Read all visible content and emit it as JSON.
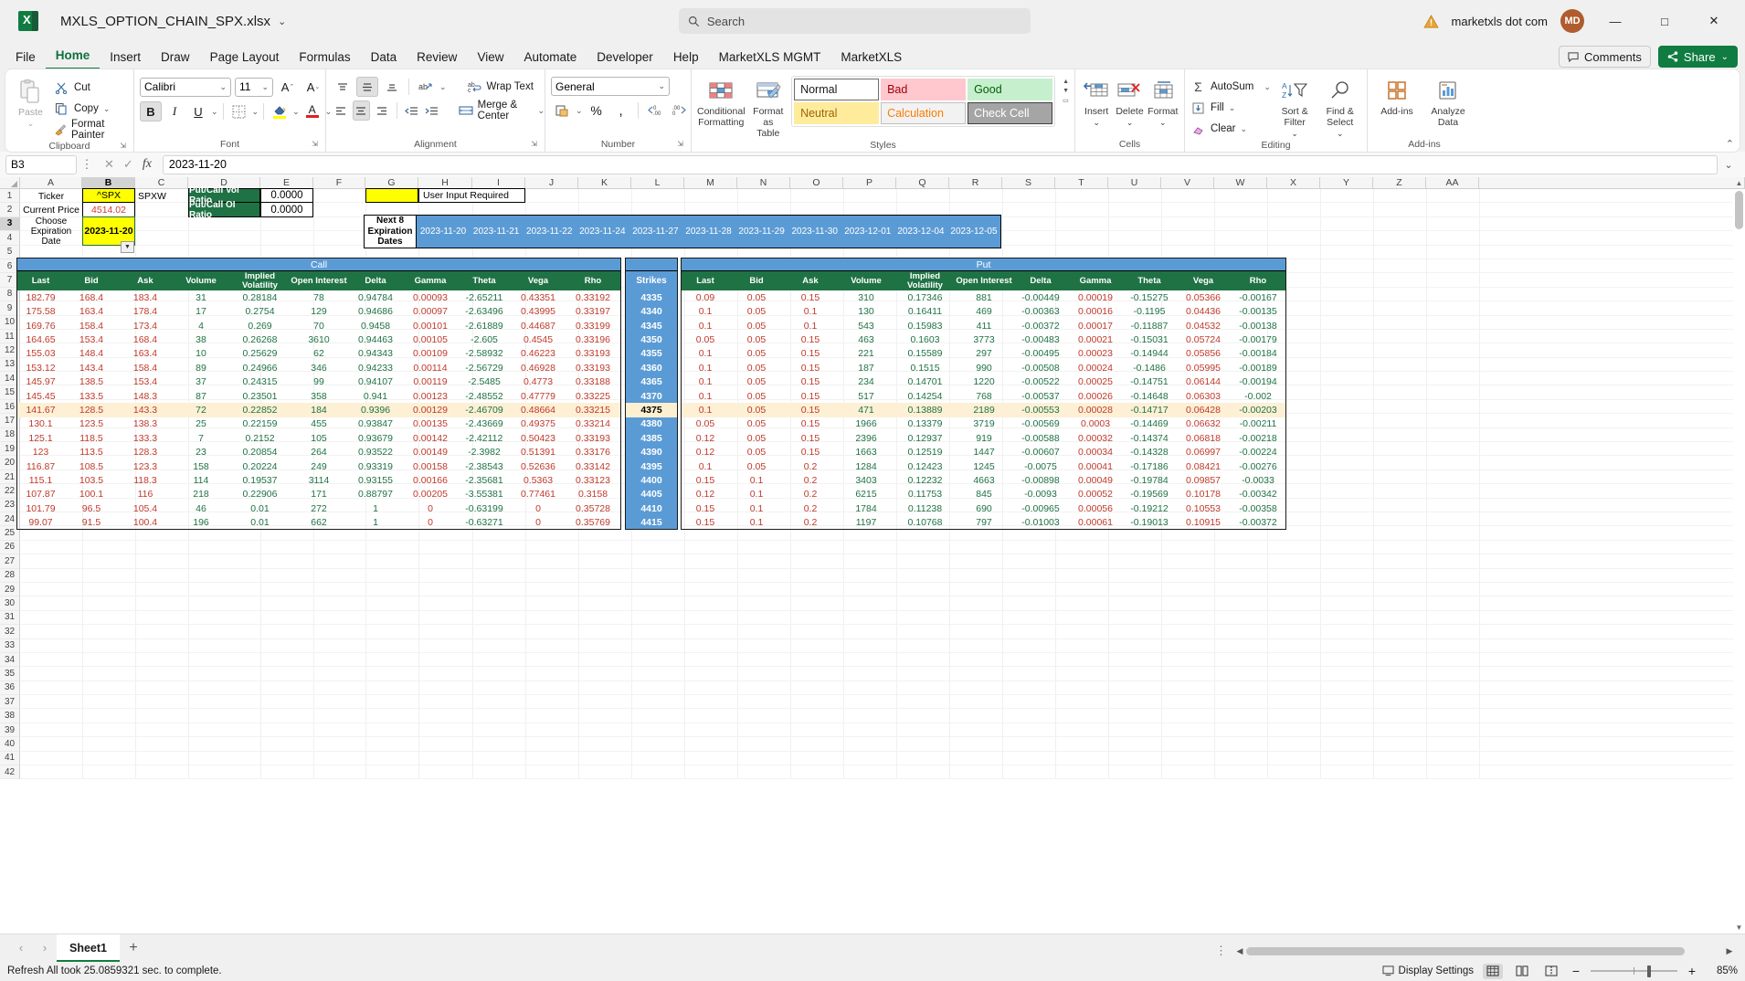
{
  "titlebar": {
    "filename": "MXLS_OPTION_CHAIN_SPX.xlsx",
    "chevron": "⌄",
    "search_placeholder": "Search",
    "search_icon": "search-icon",
    "warning_icon": "warning-triangle-icon",
    "account_name": "marketxls dot com",
    "avatar_initials": "MD",
    "minimize": "—",
    "maximize": "□",
    "close": "✕"
  },
  "ribbon_tabs": [
    {
      "label": "File",
      "active": false
    },
    {
      "label": "Home",
      "active": true
    },
    {
      "label": "Insert",
      "active": false
    },
    {
      "label": "Draw",
      "active": false
    },
    {
      "label": "Page Layout",
      "active": false
    },
    {
      "label": "Formulas",
      "active": false
    },
    {
      "label": "Data",
      "active": false
    },
    {
      "label": "Review",
      "active": false
    },
    {
      "label": "View",
      "active": false
    },
    {
      "label": "Automate",
      "active": false
    },
    {
      "label": "Developer",
      "active": false
    },
    {
      "label": "Help",
      "active": false
    },
    {
      "label": "MarketXLS MGMT",
      "active": false
    },
    {
      "label": "MarketXLS",
      "active": false
    }
  ],
  "tab_right": {
    "comments_label": "Comments",
    "comments_icon": "comment-icon",
    "share_label": "Share",
    "share_icon": "share-icon",
    "share_chevron": "⌄"
  },
  "ribbon": {
    "clipboard": {
      "group_label": "Clipboard",
      "paste_label": "Paste",
      "paste_icon": "clipboard-icon",
      "cut_label": "Cut",
      "cut_icon": "scissors-icon",
      "copy_label": "Copy",
      "copy_icon": "copy-icon",
      "format_painter_label": "Format Painter",
      "format_painter_icon": "paintbrush-icon",
      "dialog_launcher": "⇲"
    },
    "font": {
      "group_label": "Font",
      "font_family": "Calibri",
      "font_size": "11",
      "grow_icon": "increase-font-size-icon",
      "shrink_icon": "decrease-font-size-icon",
      "bold": "B",
      "italic": "I",
      "underline": "U",
      "borders_icon": "borders-icon",
      "fill_icon": "fill-color-icon",
      "font_color_icon": "font-color-icon",
      "dialog_launcher": "⇲"
    },
    "alignment": {
      "group_label": "Alignment",
      "wrap_text_label": "Wrap Text",
      "wrap_text_icon": "wrap-text-icon",
      "merge_label": "Merge & Center",
      "merge_icon": "merge-cells-icon",
      "orientation_icon": "text-orientation-icon",
      "dialog_launcher": "⇲"
    },
    "number": {
      "group_label": "Number",
      "format": "General",
      "accounting_icon": "accounting-format-icon",
      "percent_icon": "percent-style-icon",
      "comma_icon": "comma-style-icon",
      "dec_decrease_icon": "decrease-decimal-icon",
      "dec_increase_icon": "increase-decimal-icon",
      "dialog_launcher": "⇲"
    },
    "styles": {
      "group_label": "Styles",
      "conditional_formatting_label": "Conditional Formatting",
      "conditional_formatting_icon": "conditional-formatting-icon",
      "format_as_table_label": "Format as Table",
      "format_as_table_icon": "format-as-table-icon",
      "cells": [
        {
          "label": "Normal",
          "bg": "#ffffff",
          "fg": "#1a1a1a",
          "border": "#6b6b6b"
        },
        {
          "label": "Bad",
          "bg": "#ffc7ce",
          "fg": "#9c0006",
          "border": "transparent"
        },
        {
          "label": "Good",
          "bg": "#c6efce",
          "fg": "#006100",
          "border": "transparent"
        },
        {
          "label": "Neutral",
          "bg": "#ffeb9c",
          "fg": "#9c6500",
          "border": "transparent"
        },
        {
          "label": "Calculation",
          "bg": "#f2f2f2",
          "fg": "#fa7d00",
          "border": "#bfbfbf"
        },
        {
          "label": "Check Cell",
          "bg": "#a5a5a5",
          "fg": "#ffffff",
          "border": "#3f3f3f"
        }
      ],
      "scroll_up": "▲",
      "scroll_down": "▼",
      "scroll_more": "▭"
    },
    "cells": {
      "group_label": "Cells",
      "insert_label": "Insert",
      "insert_icon": "insert-cells-icon",
      "delete_label": "Delete",
      "delete_icon": "delete-cells-icon",
      "format_label": "Format",
      "format_icon": "format-cells-icon"
    },
    "editing": {
      "group_label": "Editing",
      "autosum_label": "AutoSum",
      "autosum_icon": "sigma-icon",
      "fill_label": "Fill",
      "fill_icon": "fill-down-icon",
      "clear_label": "Clear",
      "clear_icon": "eraser-icon",
      "sort_filter_label": "Sort & Filter",
      "sort_filter_icon": "sort-filter-icon",
      "find_select_label": "Find & Select",
      "find_select_icon": "magnifier-icon"
    },
    "addins": {
      "group_label": "Add-ins",
      "addins_label": "Add-ins",
      "addins_icon": "addins-grid-icon",
      "analyze_label": "Analyze Data",
      "analyze_icon": "analyze-data-icon"
    },
    "collapse_icon": "⌃"
  },
  "formula_bar": {
    "name_box": "B3",
    "name_chevron": "⌄",
    "more_icon": "⋮",
    "cancel_icon": "✕",
    "enter_icon": "✓",
    "fx_icon": "fx",
    "formula_value": "2023-11-20",
    "expand_chevron": "⌄"
  },
  "grid": {
    "columns": [
      "A",
      "B",
      "C",
      "D",
      "E",
      "F",
      "G",
      "H",
      "I",
      "J",
      "K",
      "L",
      "M",
      "N",
      "O",
      "P",
      "Q",
      "R",
      "S",
      "T",
      "U",
      "V",
      "W",
      "X",
      "Y",
      "Z",
      "AA"
    ],
    "selected_column": "B",
    "selected_row": "3",
    "rows": [
      "1",
      "2",
      "3",
      "4",
      "5",
      "6",
      "7",
      "8",
      "9",
      "10",
      "11",
      "12",
      "13",
      "14",
      "15",
      "16",
      "17",
      "18",
      "19",
      "20",
      "21",
      "22",
      "23",
      "24",
      "25",
      "26",
      "27",
      "28",
      "29",
      "30",
      "31",
      "32",
      "33",
      "34",
      "35",
      "36",
      "37",
      "38",
      "39",
      "40",
      "41",
      "42"
    ]
  },
  "panel": {
    "ticker_label": "Ticker",
    "ticker_value": "^SPX",
    "ticker_suffix": "SPXW",
    "current_price_label": "Current Price",
    "current_price_value": "4514.02",
    "choose_expiration_label": "Choose Expiration Date",
    "chosen_expiration": "2023-11-20",
    "dropdown_icon": "dropdown-arrow-icon",
    "put_call_vol_ratio_label": "Put/Call Vol Ratio",
    "put_call_vol_ratio_value": "0.0000",
    "put_call_oi_ratio_label": "Put/Call OI Ratio",
    "put_call_oi_ratio_value": "0.0000",
    "user_input_legend": "User Input Required",
    "next8_label": "Next 8 Expiration Dates",
    "expirations": [
      "2023-11-20",
      "2023-11-21",
      "2023-11-22",
      "2023-11-24",
      "2023-11-27",
      "2023-11-28",
      "2023-11-29",
      "2023-11-30",
      "2023-12-01",
      "2023-12-04",
      "2023-12-05"
    ]
  },
  "option_chain": {
    "call_section_label": "Call",
    "put_section_label": "Put",
    "strikes_label": "Strikes",
    "call_headers": [
      "Last",
      "Bid",
      "Ask",
      "Volume",
      "Implied Volatility",
      "Open Interest",
      "Delta",
      "Gamma",
      "Theta",
      "Vega",
      "Rho"
    ],
    "put_headers": [
      "Last",
      "Bid",
      "Ask",
      "Volume",
      "Implied Volatility",
      "Open Interest",
      "Delta",
      "Gamma",
      "Theta",
      "Vega",
      "Rho"
    ],
    "highlighted_strike": "4375",
    "rows": [
      {
        "row": "8",
        "strike": "4335",
        "call": [
          "182.79",
          "168.4",
          "183.4",
          "31",
          "0.28184",
          "78",
          "0.94784",
          "0.00093",
          "-2.65211",
          "0.43351",
          "0.33192"
        ],
        "put": [
          "0.09",
          "0.05",
          "0.15",
          "310",
          "0.17346",
          "881",
          "-0.00449",
          "0.00019",
          "-0.15275",
          "0.05366",
          "-0.00167"
        ]
      },
      {
        "row": "9",
        "strike": "4340",
        "call": [
          "175.58",
          "163.4",
          "178.4",
          "17",
          "0.2754",
          "129",
          "0.94686",
          "0.00097",
          "-2.63496",
          "0.43995",
          "0.33197"
        ],
        "put": [
          "0.1",
          "0.05",
          "0.1",
          "130",
          "0.16411",
          "469",
          "-0.00363",
          "0.00016",
          "-0.1195",
          "0.04436",
          "-0.00135"
        ]
      },
      {
        "row": "10",
        "strike": "4345",
        "call": [
          "169.76",
          "158.4",
          "173.4",
          "4",
          "0.269",
          "70",
          "0.9458",
          "0.00101",
          "-2.61889",
          "0.44687",
          "0.33199"
        ],
        "put": [
          "0.1",
          "0.05",
          "0.1",
          "543",
          "0.15983",
          "411",
          "-0.00372",
          "0.00017",
          "-0.11887",
          "0.04532",
          "-0.00138"
        ]
      },
      {
        "row": "11",
        "strike": "4350",
        "call": [
          "164.65",
          "153.4",
          "168.4",
          "38",
          "0.26268",
          "3610",
          "0.94463",
          "0.00105",
          "-2.605",
          "0.4545",
          "0.33196"
        ],
        "put": [
          "0.05",
          "0.05",
          "0.15",
          "463",
          "0.1603",
          "3773",
          "-0.00483",
          "0.00021",
          "-0.15031",
          "0.05724",
          "-0.00179"
        ]
      },
      {
        "row": "12",
        "strike": "4355",
        "call": [
          "155.03",
          "148.4",
          "163.4",
          "10",
          "0.25629",
          "62",
          "0.94343",
          "0.00109",
          "-2.58932",
          "0.46223",
          "0.33193"
        ],
        "put": [
          "0.1",
          "0.05",
          "0.15",
          "221",
          "0.15589",
          "297",
          "-0.00495",
          "0.00023",
          "-0.14944",
          "0.05856",
          "-0.00184"
        ]
      },
      {
        "row": "13",
        "strike": "4360",
        "call": [
          "153.12",
          "143.4",
          "158.4",
          "89",
          "0.24966",
          "346",
          "0.94233",
          "0.00114",
          "-2.56729",
          "0.46928",
          "0.33193"
        ],
        "put": [
          "0.1",
          "0.05",
          "0.15",
          "187",
          "0.1515",
          "990",
          "-0.00508",
          "0.00024",
          "-0.1486",
          "0.05995",
          "-0.00189"
        ]
      },
      {
        "row": "14",
        "strike": "4365",
        "call": [
          "145.97",
          "138.5",
          "153.4",
          "37",
          "0.24315",
          "99",
          "0.94107",
          "0.00119",
          "-2.5485",
          "0.4773",
          "0.33188"
        ],
        "put": [
          "0.1",
          "0.05",
          "0.15",
          "234",
          "0.14701",
          "1220",
          "-0.00522",
          "0.00025",
          "-0.14751",
          "0.06144",
          "-0.00194"
        ]
      },
      {
        "row": "15",
        "strike": "4370",
        "call": [
          "145.45",
          "133.5",
          "148.3",
          "87",
          "0.23501",
          "358",
          "0.941",
          "0.00123",
          "-2.48552",
          "0.47779",
          "0.33225"
        ],
        "put": [
          "0.1",
          "0.05",
          "0.15",
          "517",
          "0.14254",
          "768",
          "-0.00537",
          "0.00026",
          "-0.14648",
          "0.06303",
          "-0.002"
        ]
      },
      {
        "row": "16",
        "strike": "4375",
        "call": [
          "141.67",
          "128.5",
          "143.3",
          "72",
          "0.22852",
          "184",
          "0.9396",
          "0.00129",
          "-2.46709",
          "0.48664",
          "0.33215"
        ],
        "put": [
          "0.1",
          "0.05",
          "0.15",
          "471",
          "0.13889",
          "2189",
          "-0.00553",
          "0.00028",
          "-0.14717",
          "0.06428",
          "-0.00203"
        ]
      },
      {
        "row": "17",
        "strike": "4380",
        "call": [
          "130.1",
          "123.5",
          "138.3",
          "25",
          "0.22159",
          "455",
          "0.93847",
          "0.00135",
          "-2.43669",
          "0.49375",
          "0.33214"
        ],
        "put": [
          "0.05",
          "0.05",
          "0.15",
          "1966",
          "0.13379",
          "3719",
          "-0.00569",
          "0.0003",
          "-0.14469",
          "0.06632",
          "-0.00211"
        ]
      },
      {
        "row": "18",
        "strike": "4385",
        "call": [
          "125.1",
          "118.5",
          "133.3",
          "7",
          "0.2152",
          "105",
          "0.93679",
          "0.00142",
          "-2.42112",
          "0.50423",
          "0.33193"
        ],
        "put": [
          "0.12",
          "0.05",
          "0.15",
          "2396",
          "0.12937",
          "919",
          "-0.00588",
          "0.00032",
          "-0.14374",
          "0.06818",
          "-0.00218"
        ]
      },
      {
        "row": "19",
        "strike": "4390",
        "call": [
          "123",
          "113.5",
          "128.3",
          "23",
          "0.20854",
          "264",
          "0.93522",
          "0.00149",
          "-2.3982",
          "0.51391",
          "0.33176"
        ],
        "put": [
          "0.12",
          "0.05",
          "0.15",
          "1663",
          "0.12519",
          "1447",
          "-0.00607",
          "0.00034",
          "-0.14328",
          "0.06997",
          "-0.00224"
        ]
      },
      {
        "row": "20",
        "strike": "4395",
        "call": [
          "116.87",
          "108.5",
          "123.3",
          "158",
          "0.20224",
          "249",
          "0.93319",
          "0.00158",
          "-2.38543",
          "0.52636",
          "0.33142"
        ],
        "put": [
          "0.1",
          "0.05",
          "0.2",
          "1284",
          "0.12423",
          "1245",
          "-0.0075",
          "0.00041",
          "-0.17186",
          "0.08421",
          "-0.00276"
        ]
      },
      {
        "row": "21",
        "strike": "4400",
        "call": [
          "115.1",
          "103.5",
          "118.3",
          "114",
          "0.19537",
          "3114",
          "0.93155",
          "0.00166",
          "-2.35681",
          "0.5363",
          "0.33123"
        ],
        "put": [
          "0.15",
          "0.1",
          "0.2",
          "3403",
          "0.12232",
          "4663",
          "-0.00898",
          "0.00049",
          "-0.19784",
          "0.09857",
          "-0.0033"
        ]
      },
      {
        "row": "22",
        "strike": "4405",
        "call": [
          "107.87",
          "100.1",
          "116",
          "218",
          "0.22906",
          "171",
          "0.88797",
          "0.00205",
          "-3.55381",
          "0.77461",
          "0.3158"
        ],
        "put": [
          "0.12",
          "0.1",
          "0.2",
          "6215",
          "0.11753",
          "845",
          "-0.0093",
          "0.00052",
          "-0.19569",
          "0.10178",
          "-0.00342"
        ]
      },
      {
        "row": "23",
        "strike": "4410",
        "call": [
          "101.79",
          "96.5",
          "105.4",
          "46",
          "0.01",
          "272",
          "1",
          "0",
          "-0.63199",
          "0",
          "0.35728"
        ],
        "put": [
          "0.15",
          "0.1",
          "0.2",
          "1784",
          "0.11238",
          "690",
          "-0.00965",
          "0.00056",
          "-0.19212",
          "0.10553",
          "-0.00358"
        ]
      },
      {
        "row": "24",
        "strike": "4415",
        "call": [
          "99.07",
          "91.5",
          "100.4",
          "196",
          "0.01",
          "662",
          "1",
          "0",
          "-0.63271",
          "0",
          "0.35769"
        ],
        "put": [
          "0.15",
          "0.1",
          "0.2",
          "1197",
          "0.10768",
          "797",
          "-0.01003",
          "0.00061",
          "-0.19013",
          "0.10915",
          "-0.00372"
        ]
      }
    ],
    "call_colors": [
      "#c0392b",
      "#c0392b",
      "#c0392b",
      "#1f7244",
      "#1f7244",
      "#1f7244",
      "#1f7244",
      "#c0392b",
      "#1f7244",
      "#c0392b",
      "#c0392b"
    ],
    "put_colors": [
      "#c0392b",
      "#c0392b",
      "#c0392b",
      "#1f7244",
      "#1f7244",
      "#1f7244",
      "#1f7244",
      "#c0392b",
      "#1f7244",
      "#c0392b",
      "#1f7244"
    ]
  },
  "sheet_tabs": {
    "prev_icon": "‹",
    "next_icon": "›",
    "tabs": [
      {
        "label": "Sheet1",
        "active": true
      }
    ],
    "add_icon": "+",
    "context_dots": "⋮"
  },
  "statusbar": {
    "message": "Refresh All took 25.0859321 sec. to complete.",
    "display_settings_label": "Display Settings",
    "display_settings_icon": "display-settings-icon",
    "normal_view_icon": "normal-view-icon",
    "page_layout_icon": "page-layout-view-icon",
    "page_break_icon": "page-break-view-icon",
    "zoom_out": "−",
    "zoom_in": "+",
    "zoom_level": "85%"
  },
  "theme": {
    "excel_green": "#107c41",
    "header_green": "#1f7244",
    "section_blue": "#5b9bd5",
    "yellow_input": "#ffff00",
    "highlight_row": "#fdf0d5",
    "negative_red": "#c0392b",
    "positive_green": "#1f7244"
  }
}
